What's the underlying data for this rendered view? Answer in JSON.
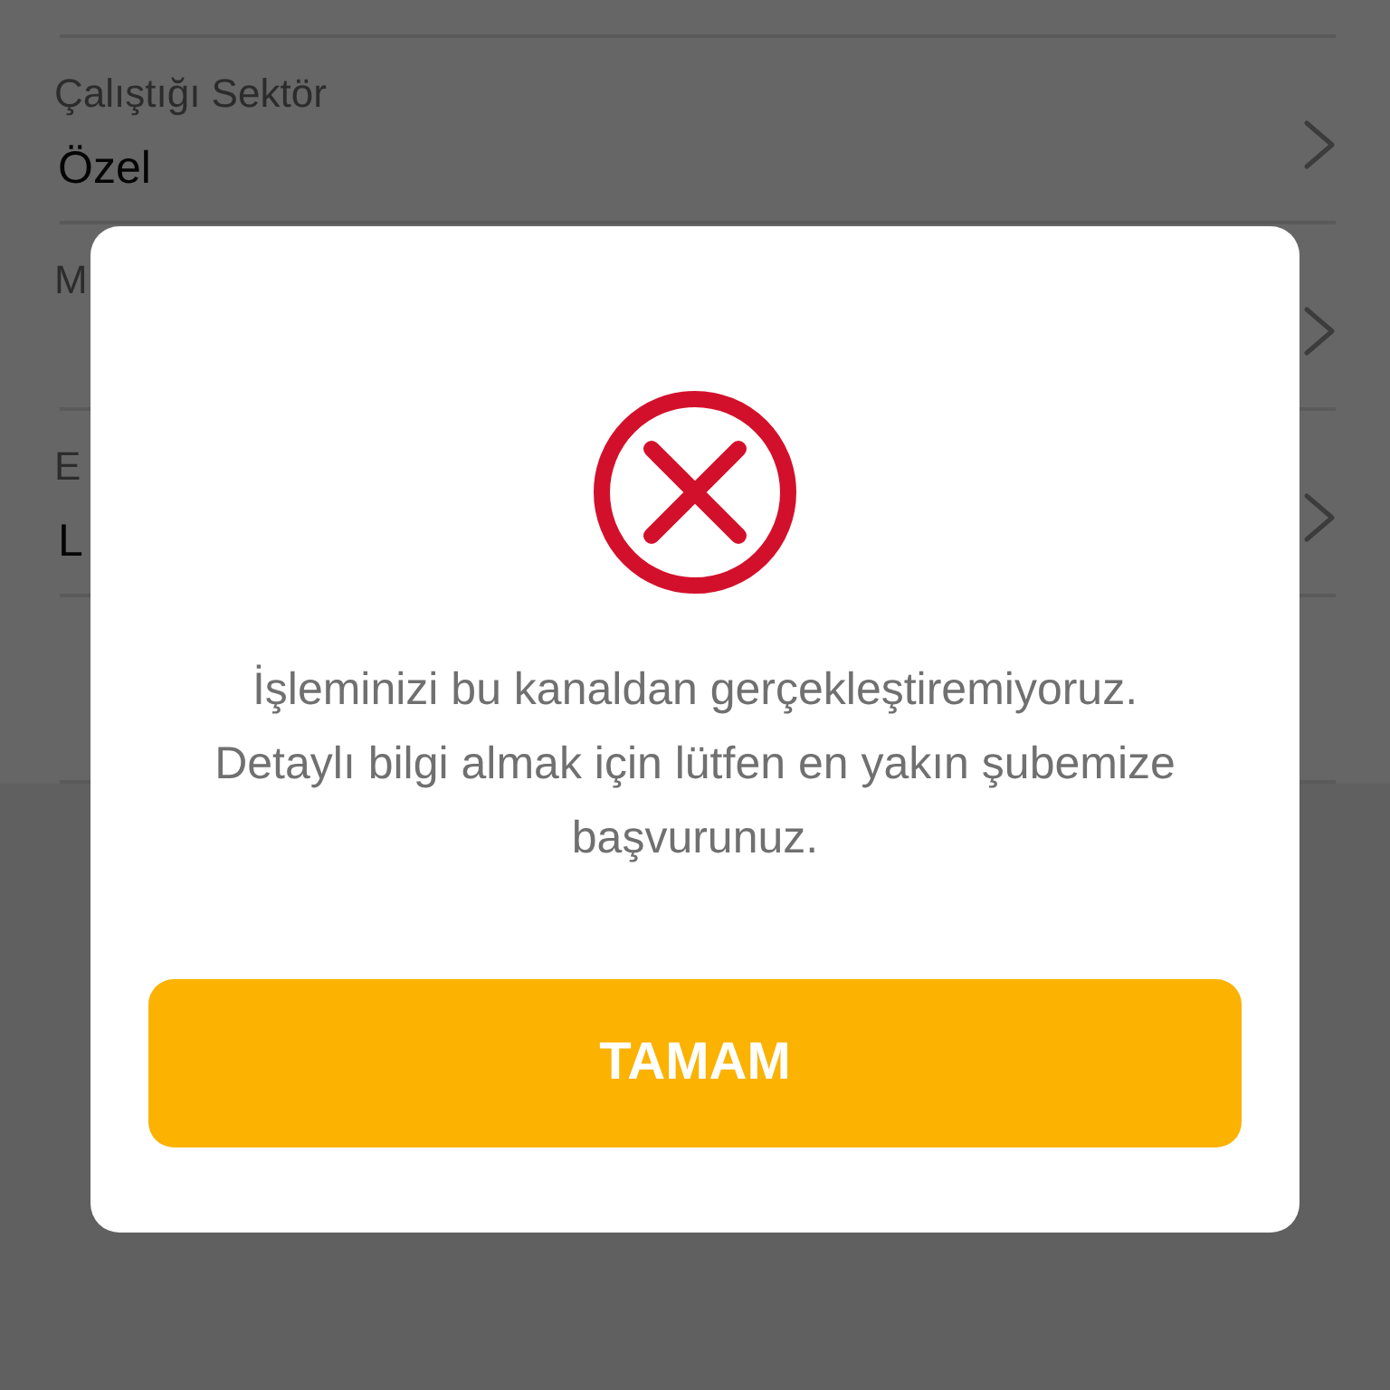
{
  "form": {
    "fields": [
      {
        "kind": "select",
        "label": "Çalıştığı Sektör",
        "value": "Özel"
      },
      {
        "kind": "select",
        "label": "M"
      },
      {
        "kind": "select",
        "label": "E",
        "value": "L"
      },
      {
        "kind": "input"
      }
    ]
  },
  "dialog": {
    "kind": "error",
    "message": "İşleminizi bu kanaldan gerçekleştiremiyoruz. Detaylı bilgi almak için lütfen en yakın şubemize başvurunuz.",
    "button": "TAMAM"
  }
}
